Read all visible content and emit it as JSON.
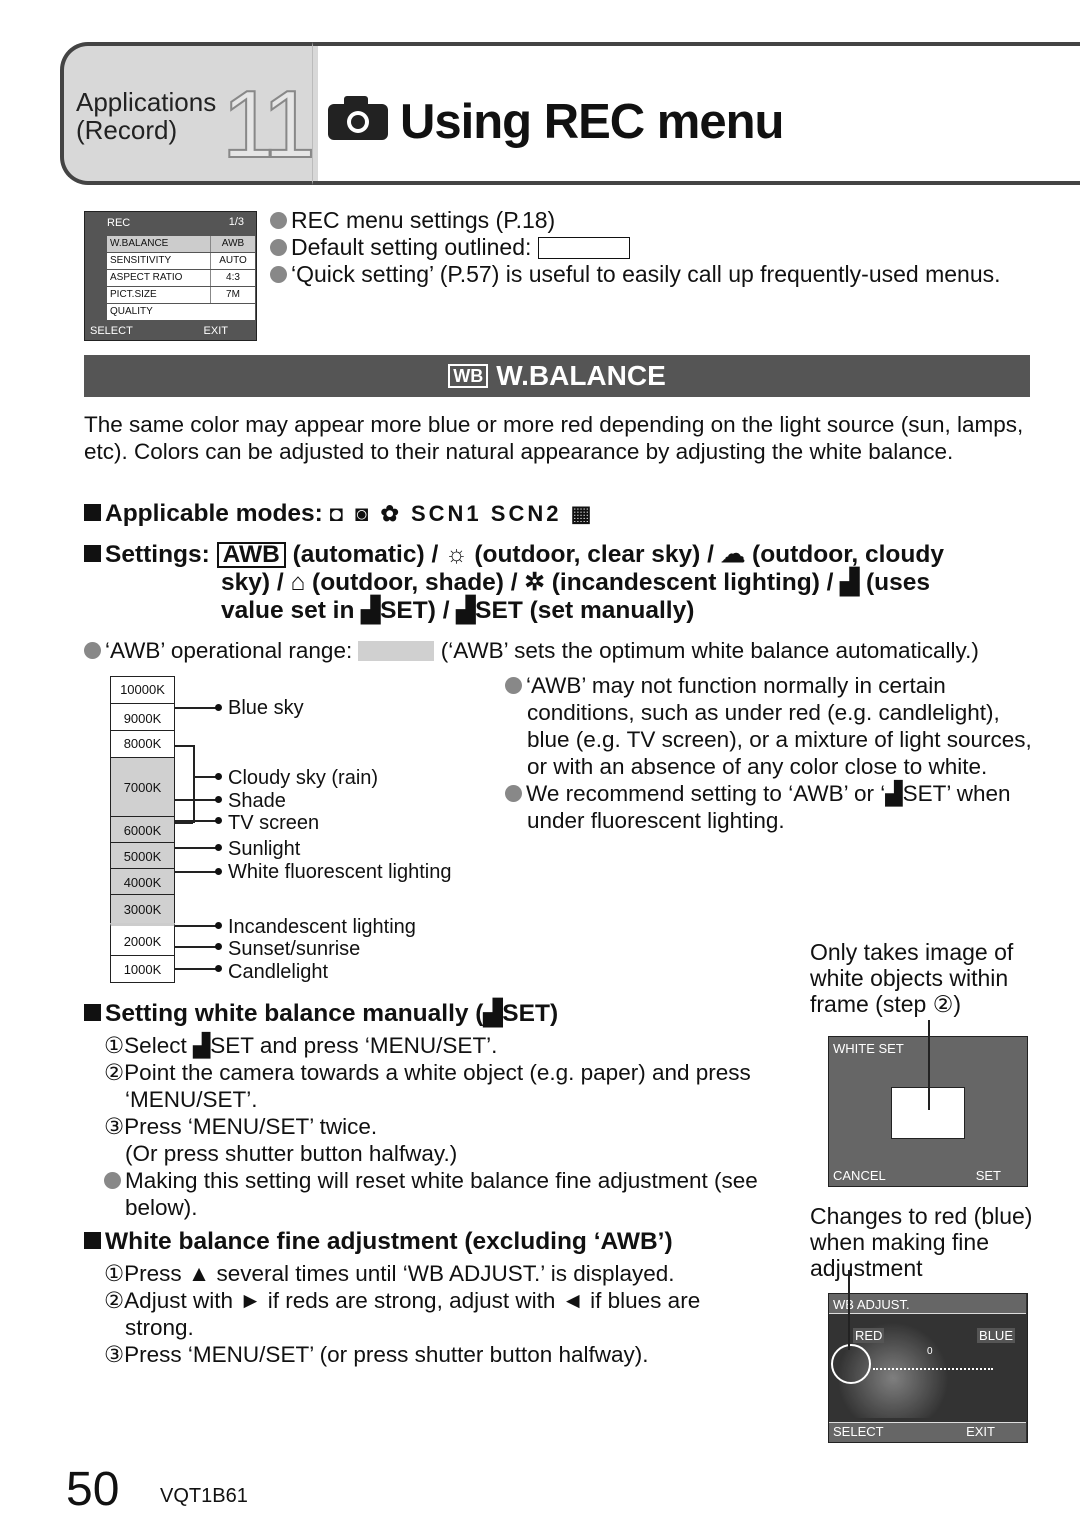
{
  "header": {
    "section": "Applications",
    "subsection": "(Record)",
    "chapter": "11",
    "title": "Using REC menu",
    "icon": "camera-icon"
  },
  "lcd_menu": {
    "title": "REC",
    "page": "1/3",
    "items": [
      {
        "label": "W.BALANCE",
        "value": "AWB"
      },
      {
        "label": "SENSITIVITY",
        "value": "AUTO"
      },
      {
        "label": "ASPECT RATIO",
        "value": "4:3"
      },
      {
        "label": "PICT.SIZE",
        "value": "7M"
      },
      {
        "label": "QUALITY",
        "value": ""
      }
    ],
    "footer_left": "SELECT",
    "footer_right": "EXIT"
  },
  "intro_bullets": [
    "REC menu settings (P.18)",
    "Default setting outlined:",
    "‘Quick setting’ (P.57) is useful to easily call up frequently-used menus."
  ],
  "section_title": "W.BALANCE",
  "description": "The same color may appear more blue or more red depending on the light source (sun, lamps, etc). Colors can be adjusted to their natural appearance by adjusting the white balance.",
  "applicable_modes_label": "Applicable modes:",
  "settings": {
    "label": "Settings:",
    "awb": "AWB",
    "line1": "(automatic) / ☼ (outdoor, clear sky) / ☁ (outdoor, cloudy",
    "line2": "sky) / ⌂ (outdoor, shade) / ✲ (incandescent lighting) / ▟ (uses",
    "line3": "value set in ▟SET) / ▟SET (set manually)"
  },
  "awb_range": {
    "label": "‘AWB’ operational range:",
    "note": "(‘AWB’ sets the optimum white balance automatically.)"
  },
  "color_temp_chart": {
    "kelvin": [
      "10000K",
      "9000K",
      "8000K",
      "7000K",
      "6000K",
      "5000K",
      "4000K",
      "3000K",
      "2000K",
      "1000K"
    ],
    "sources": [
      "Blue sky",
      "Cloudy sky (rain)",
      "Shade",
      "TV screen",
      "Sunlight",
      "White fluorescent lighting",
      "Incandescent lighting",
      "Sunset/sunrise",
      "Candlelight"
    ]
  },
  "right_notes": [
    "‘AWB’ may not function normally in certain conditions, such as under red (e.g. candlelight), blue (e.g. TV screen), or a mixture of light sources, or with an absence of any color close to white.",
    "We recommend setting to ‘AWB’ or ‘▟SET’ when under fluorescent lighting."
  ],
  "manual": {
    "heading": "Setting white balance manually (▟SET)",
    "steps": [
      "①Select ▟SET and press ‘MENU/SET’.",
      "②Point the camera towards a white object (e.g. paper) and press ‘MENU/SET’.",
      "③Press ‘MENU/SET’ twice.",
      "(Or press shutter button halfway.)"
    ],
    "note": "Making this setting will reset white balance fine adjustment (see below)."
  },
  "fine": {
    "heading": "White balance fine adjustment (excluding ‘AWB’)",
    "steps": [
      "①Press ▲ several times until ‘WB ADJUST.’ is displayed.",
      "②Adjust with ► if reds are strong, adjust with ◄ if blues are strong.",
      "③Press ‘MENU/SET’ (or press shutter button halfway)."
    ]
  },
  "white_set_caption": "Only takes image of white objects within frame (step ②)",
  "white_set_screen": {
    "title": "WHITE SET",
    "cancel": "CANCEL",
    "set": "SET"
  },
  "wb_adjust_caption": "Changes to red (blue) when making fine adjustment",
  "wb_adjust_screen": {
    "title": "WB ADJUST.",
    "red": "RED",
    "blue": "BLUE",
    "zero": "0",
    "select": "SELECT",
    "exit": "EXIT"
  },
  "footer": {
    "page": "50",
    "code": "VQT1B61"
  }
}
